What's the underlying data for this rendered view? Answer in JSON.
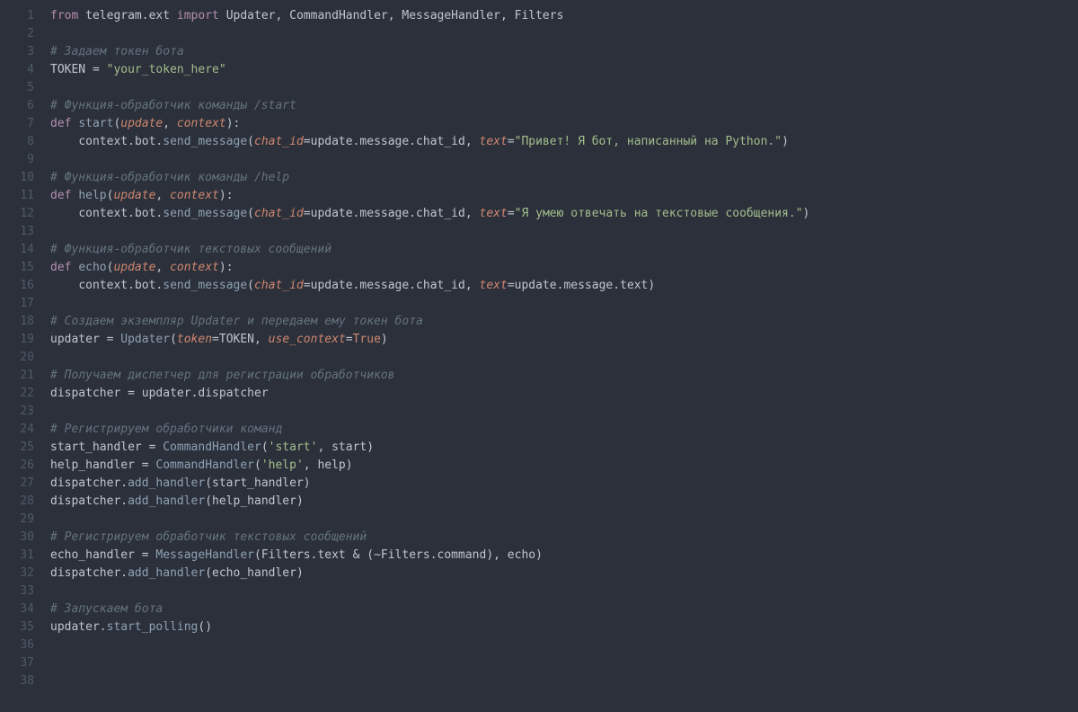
{
  "lineCount": 38,
  "lines": {
    "1": [
      {
        "cls": "kw",
        "t": "from"
      },
      {
        "cls": "",
        "t": " "
      },
      {
        "cls": "name",
        "t": "telegram"
      },
      {
        "cls": "pn",
        "t": "."
      },
      {
        "cls": "name",
        "t": "ext"
      },
      {
        "cls": "",
        "t": " "
      },
      {
        "cls": "kw",
        "t": "import"
      },
      {
        "cls": "",
        "t": " "
      },
      {
        "cls": "name",
        "t": "Updater"
      },
      {
        "cls": "pn",
        "t": ", "
      },
      {
        "cls": "name",
        "t": "CommandHandler"
      },
      {
        "cls": "pn",
        "t": ", "
      },
      {
        "cls": "name",
        "t": "MessageHandler"
      },
      {
        "cls": "pn",
        "t": ", "
      },
      {
        "cls": "name",
        "t": "Filters"
      }
    ],
    "2": [],
    "3": [
      {
        "cls": "cmt",
        "t": "# Задаем токен бота"
      }
    ],
    "4": [
      {
        "cls": "name",
        "t": "TOKEN"
      },
      {
        "cls": "",
        "t": " "
      },
      {
        "cls": "op",
        "t": "="
      },
      {
        "cls": "",
        "t": " "
      },
      {
        "cls": "str",
        "t": "\"your_token_here\""
      }
    ],
    "5": [],
    "6": [
      {
        "cls": "cmt",
        "t": "# Функция-обработчик команды /start"
      }
    ],
    "7": [
      {
        "cls": "kw",
        "t": "def"
      },
      {
        "cls": "",
        "t": " "
      },
      {
        "cls": "fn",
        "t": "start"
      },
      {
        "cls": "pn",
        "t": "("
      },
      {
        "cls": "param",
        "t": "update"
      },
      {
        "cls": "pn",
        "t": ", "
      },
      {
        "cls": "param",
        "t": "context"
      },
      {
        "cls": "pn",
        "t": "):"
      }
    ],
    "8": [
      {
        "cls": "",
        "t": "    "
      },
      {
        "cls": "name",
        "t": "context"
      },
      {
        "cls": "pn",
        "t": "."
      },
      {
        "cls": "name",
        "t": "bot"
      },
      {
        "cls": "pn",
        "t": "."
      },
      {
        "cls": "fn",
        "t": "send_message"
      },
      {
        "cls": "pn",
        "t": "("
      },
      {
        "cls": "param",
        "t": "chat_id"
      },
      {
        "cls": "op",
        "t": "="
      },
      {
        "cls": "name",
        "t": "update"
      },
      {
        "cls": "pn",
        "t": "."
      },
      {
        "cls": "name",
        "t": "message"
      },
      {
        "cls": "pn",
        "t": "."
      },
      {
        "cls": "name",
        "t": "chat_id"
      },
      {
        "cls": "pn",
        "t": ", "
      },
      {
        "cls": "param",
        "t": "text"
      },
      {
        "cls": "op",
        "t": "="
      },
      {
        "cls": "str",
        "t": "\"Привет! Я бот, написанный на Python.\""
      },
      {
        "cls": "pn",
        "t": ")"
      }
    ],
    "9": [],
    "10": [
      {
        "cls": "cmt",
        "t": "# Функция-обработчик команды /help"
      }
    ],
    "11": [
      {
        "cls": "kw",
        "t": "def"
      },
      {
        "cls": "",
        "t": " "
      },
      {
        "cls": "fn",
        "t": "help"
      },
      {
        "cls": "pn",
        "t": "("
      },
      {
        "cls": "param",
        "t": "update"
      },
      {
        "cls": "pn",
        "t": ", "
      },
      {
        "cls": "param",
        "t": "context"
      },
      {
        "cls": "pn",
        "t": "):"
      }
    ],
    "12": [
      {
        "cls": "",
        "t": "    "
      },
      {
        "cls": "name",
        "t": "context"
      },
      {
        "cls": "pn",
        "t": "."
      },
      {
        "cls": "name",
        "t": "bot"
      },
      {
        "cls": "pn",
        "t": "."
      },
      {
        "cls": "fn",
        "t": "send_message"
      },
      {
        "cls": "pn",
        "t": "("
      },
      {
        "cls": "param",
        "t": "chat_id"
      },
      {
        "cls": "op",
        "t": "="
      },
      {
        "cls": "name",
        "t": "update"
      },
      {
        "cls": "pn",
        "t": "."
      },
      {
        "cls": "name",
        "t": "message"
      },
      {
        "cls": "pn",
        "t": "."
      },
      {
        "cls": "name",
        "t": "chat_id"
      },
      {
        "cls": "pn",
        "t": ", "
      },
      {
        "cls": "param",
        "t": "text"
      },
      {
        "cls": "op",
        "t": "="
      },
      {
        "cls": "str",
        "t": "\"Я умею отвечать на текстовые сообщения.\""
      },
      {
        "cls": "pn",
        "t": ")"
      }
    ],
    "13": [],
    "14": [
      {
        "cls": "cmt",
        "t": "# Функция-обработчик текстовых сообщений"
      }
    ],
    "15": [
      {
        "cls": "kw",
        "t": "def"
      },
      {
        "cls": "",
        "t": " "
      },
      {
        "cls": "fn",
        "t": "echo"
      },
      {
        "cls": "pn",
        "t": "("
      },
      {
        "cls": "param",
        "t": "update"
      },
      {
        "cls": "pn",
        "t": ", "
      },
      {
        "cls": "param",
        "t": "context"
      },
      {
        "cls": "pn",
        "t": "):"
      }
    ],
    "16": [
      {
        "cls": "",
        "t": "    "
      },
      {
        "cls": "name",
        "t": "context"
      },
      {
        "cls": "pn",
        "t": "."
      },
      {
        "cls": "name",
        "t": "bot"
      },
      {
        "cls": "pn",
        "t": "."
      },
      {
        "cls": "fn",
        "t": "send_message"
      },
      {
        "cls": "pn",
        "t": "("
      },
      {
        "cls": "param",
        "t": "chat_id"
      },
      {
        "cls": "op",
        "t": "="
      },
      {
        "cls": "name",
        "t": "update"
      },
      {
        "cls": "pn",
        "t": "."
      },
      {
        "cls": "name",
        "t": "message"
      },
      {
        "cls": "pn",
        "t": "."
      },
      {
        "cls": "name",
        "t": "chat_id"
      },
      {
        "cls": "pn",
        "t": ", "
      },
      {
        "cls": "param",
        "t": "text"
      },
      {
        "cls": "op",
        "t": "="
      },
      {
        "cls": "name",
        "t": "update"
      },
      {
        "cls": "pn",
        "t": "."
      },
      {
        "cls": "name",
        "t": "message"
      },
      {
        "cls": "pn",
        "t": "."
      },
      {
        "cls": "name",
        "t": "text"
      },
      {
        "cls": "pn",
        "t": ")"
      }
    ],
    "17": [],
    "18": [
      {
        "cls": "cmt",
        "t": "# Создаем экземпляр Updater и передаем ему токен бота"
      }
    ],
    "19": [
      {
        "cls": "name",
        "t": "updater"
      },
      {
        "cls": "",
        "t": " "
      },
      {
        "cls": "op",
        "t": "="
      },
      {
        "cls": "",
        "t": " "
      },
      {
        "cls": "fn",
        "t": "Updater"
      },
      {
        "cls": "pn",
        "t": "("
      },
      {
        "cls": "param",
        "t": "token"
      },
      {
        "cls": "op",
        "t": "="
      },
      {
        "cls": "name",
        "t": "TOKEN"
      },
      {
        "cls": "pn",
        "t": ", "
      },
      {
        "cls": "param",
        "t": "use_context"
      },
      {
        "cls": "op",
        "t": "="
      },
      {
        "cls": "const",
        "t": "True"
      },
      {
        "cls": "pn",
        "t": ")"
      }
    ],
    "20": [],
    "21": [
      {
        "cls": "cmt",
        "t": "# Получаем диспетчер для регистрации обработчиков"
      }
    ],
    "22": [
      {
        "cls": "name",
        "t": "dispatcher"
      },
      {
        "cls": "",
        "t": " "
      },
      {
        "cls": "op",
        "t": "="
      },
      {
        "cls": "",
        "t": " "
      },
      {
        "cls": "name",
        "t": "updater"
      },
      {
        "cls": "pn",
        "t": "."
      },
      {
        "cls": "name",
        "t": "dispatcher"
      }
    ],
    "23": [],
    "24": [
      {
        "cls": "cmt",
        "t": "# Регистрируем обработчики команд"
      }
    ],
    "25": [
      {
        "cls": "name",
        "t": "start_handler"
      },
      {
        "cls": "",
        "t": " "
      },
      {
        "cls": "op",
        "t": "="
      },
      {
        "cls": "",
        "t": " "
      },
      {
        "cls": "fn",
        "t": "CommandHandler"
      },
      {
        "cls": "pn",
        "t": "("
      },
      {
        "cls": "str",
        "t": "'start'"
      },
      {
        "cls": "pn",
        "t": ", "
      },
      {
        "cls": "name",
        "t": "start"
      },
      {
        "cls": "pn",
        "t": ")"
      }
    ],
    "26": [
      {
        "cls": "name",
        "t": "help_handler"
      },
      {
        "cls": "",
        "t": " "
      },
      {
        "cls": "op",
        "t": "="
      },
      {
        "cls": "",
        "t": " "
      },
      {
        "cls": "fn",
        "t": "CommandHandler"
      },
      {
        "cls": "pn",
        "t": "("
      },
      {
        "cls": "str",
        "t": "'help'"
      },
      {
        "cls": "pn",
        "t": ", "
      },
      {
        "cls": "name",
        "t": "help"
      },
      {
        "cls": "pn",
        "t": ")"
      }
    ],
    "27": [
      {
        "cls": "name",
        "t": "dispatcher"
      },
      {
        "cls": "pn",
        "t": "."
      },
      {
        "cls": "fn",
        "t": "add_handler"
      },
      {
        "cls": "pn",
        "t": "("
      },
      {
        "cls": "name",
        "t": "start_handler"
      },
      {
        "cls": "pn",
        "t": ")"
      }
    ],
    "28": [
      {
        "cls": "name",
        "t": "dispatcher"
      },
      {
        "cls": "pn",
        "t": "."
      },
      {
        "cls": "fn",
        "t": "add_handler"
      },
      {
        "cls": "pn",
        "t": "("
      },
      {
        "cls": "name",
        "t": "help_handler"
      },
      {
        "cls": "pn",
        "t": ")"
      }
    ],
    "29": [],
    "30": [
      {
        "cls": "cmt",
        "t": "# Регистрируем обработчик текстовых сообщений"
      }
    ],
    "31": [
      {
        "cls": "name",
        "t": "echo_handler"
      },
      {
        "cls": "",
        "t": " "
      },
      {
        "cls": "op",
        "t": "="
      },
      {
        "cls": "",
        "t": " "
      },
      {
        "cls": "fn",
        "t": "MessageHandler"
      },
      {
        "cls": "pn",
        "t": "("
      },
      {
        "cls": "name",
        "t": "Filters"
      },
      {
        "cls": "pn",
        "t": "."
      },
      {
        "cls": "name",
        "t": "text"
      },
      {
        "cls": "",
        "t": " "
      },
      {
        "cls": "op",
        "t": "&"
      },
      {
        "cls": "",
        "t": " "
      },
      {
        "cls": "pn",
        "t": "("
      },
      {
        "cls": "op",
        "t": "~"
      },
      {
        "cls": "name",
        "t": "Filters"
      },
      {
        "cls": "pn",
        "t": "."
      },
      {
        "cls": "name",
        "t": "command"
      },
      {
        "cls": "pn",
        "t": "), "
      },
      {
        "cls": "name",
        "t": "echo"
      },
      {
        "cls": "pn",
        "t": ")"
      }
    ],
    "32": [
      {
        "cls": "name",
        "t": "dispatcher"
      },
      {
        "cls": "pn",
        "t": "."
      },
      {
        "cls": "fn",
        "t": "add_handler"
      },
      {
        "cls": "pn",
        "t": "("
      },
      {
        "cls": "name",
        "t": "echo_handler"
      },
      {
        "cls": "pn",
        "t": ")"
      }
    ],
    "33": [],
    "34": [
      {
        "cls": "cmt",
        "t": "# Запускаем бота"
      }
    ],
    "35": [
      {
        "cls": "name",
        "t": "updater"
      },
      {
        "cls": "pn",
        "t": "."
      },
      {
        "cls": "fn",
        "t": "start_polling"
      },
      {
        "cls": "pn",
        "t": "()"
      }
    ],
    "36": [],
    "37": [],
    "38": []
  }
}
